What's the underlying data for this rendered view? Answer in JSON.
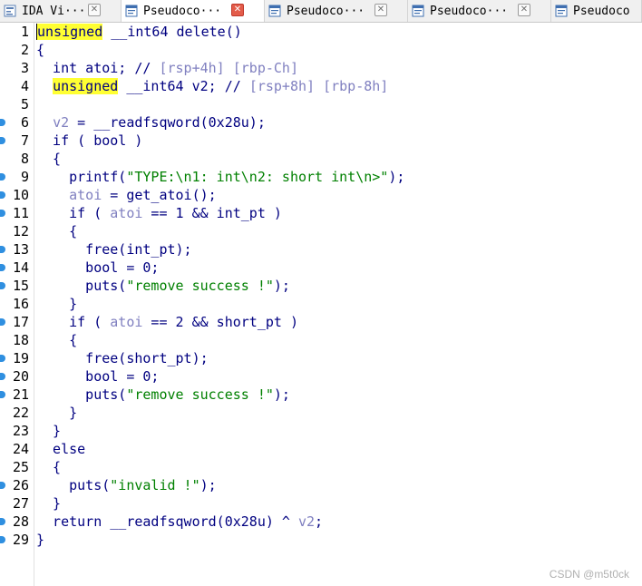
{
  "tabs": [
    {
      "label": "IDA Vi···",
      "icon": "ida-view-icon",
      "active": false
    },
    {
      "label": "Pseudoco···",
      "icon": "pseudocode-icon",
      "active": true
    },
    {
      "label": "Pseudoco···",
      "icon": "pseudocode-icon",
      "active": false
    },
    {
      "label": "Pseudoco···",
      "icon": "pseudocode-icon",
      "active": false
    },
    {
      "label": "Pseudoco",
      "icon": "pseudocode-icon",
      "active": false
    }
  ],
  "colors": {
    "keyword": "#000080",
    "highlight": "#ffff33",
    "comment": "#8080c0",
    "string": "#008000",
    "breakpoint_dot": "#2f8fe0",
    "active_close": "#e35c4a"
  },
  "code_lines": [
    {
      "n": "1",
      "dot": false,
      "cursor": true,
      "tokens": [
        {
          "t": "unsigned",
          "c": "hl"
        },
        {
          "t": " __int64 delete()",
          "c": "kw"
        }
      ]
    },
    {
      "n": "2",
      "dot": false,
      "tokens": [
        {
          "t": "{",
          "c": "kw"
        }
      ]
    },
    {
      "n": "3",
      "dot": false,
      "tokens": [
        {
          "t": "  int atoi; // ",
          "c": "kw"
        },
        {
          "t": "[rsp+4h] [rbp-Ch]",
          "c": "cm"
        }
      ]
    },
    {
      "n": "4",
      "dot": false,
      "tokens": [
        {
          "t": "  ",
          "c": "kw"
        },
        {
          "t": "unsigned",
          "c": "hl"
        },
        {
          "t": " __int64 v2; // ",
          "c": "kw"
        },
        {
          "t": "[rsp+8h] [rbp-8h]",
          "c": "cm"
        }
      ]
    },
    {
      "n": "5",
      "dot": false,
      "tokens": []
    },
    {
      "n": "6",
      "dot": true,
      "tokens": [
        {
          "t": "  ",
          "c": "kw"
        },
        {
          "t": "v2",
          "c": "var"
        },
        {
          "t": " = __readfsqword(0x28u);",
          "c": "kw"
        }
      ]
    },
    {
      "n": "7",
      "dot": true,
      "tokens": [
        {
          "t": "  if ( bool )",
          "c": "kw"
        }
      ]
    },
    {
      "n": "8",
      "dot": false,
      "tokens": [
        {
          "t": "  {",
          "c": "kw"
        }
      ]
    },
    {
      "n": "9",
      "dot": true,
      "tokens": [
        {
          "t": "    printf(",
          "c": "kw"
        },
        {
          "t": "\"TYPE:\\n1: int\\n2: short int\\n>\"",
          "c": "str"
        },
        {
          "t": ");",
          "c": "kw"
        }
      ]
    },
    {
      "n": "10",
      "dot": true,
      "tokens": [
        {
          "t": "    ",
          "c": "kw"
        },
        {
          "t": "atoi",
          "c": "var"
        },
        {
          "t": " = get_atoi();",
          "c": "kw"
        }
      ]
    },
    {
      "n": "11",
      "dot": true,
      "tokens": [
        {
          "t": "    if ( ",
          "c": "kw"
        },
        {
          "t": "atoi",
          "c": "var"
        },
        {
          "t": " == 1 && int_pt )",
          "c": "kw"
        }
      ]
    },
    {
      "n": "12",
      "dot": false,
      "tokens": [
        {
          "t": "    {",
          "c": "kw"
        }
      ]
    },
    {
      "n": "13",
      "dot": true,
      "tokens": [
        {
          "t": "      free(int_pt);",
          "c": "kw"
        }
      ]
    },
    {
      "n": "14",
      "dot": true,
      "tokens": [
        {
          "t": "      bool = 0;",
          "c": "kw"
        }
      ]
    },
    {
      "n": "15",
      "dot": true,
      "tokens": [
        {
          "t": "      puts(",
          "c": "kw"
        },
        {
          "t": "\"remove success !\"",
          "c": "str"
        },
        {
          "t": ");",
          "c": "kw"
        }
      ]
    },
    {
      "n": "16",
      "dot": false,
      "tokens": [
        {
          "t": "    }",
          "c": "kw"
        }
      ]
    },
    {
      "n": "17",
      "dot": true,
      "tokens": [
        {
          "t": "    if ( ",
          "c": "kw"
        },
        {
          "t": "atoi",
          "c": "var"
        },
        {
          "t": " == 2 && short_pt )",
          "c": "kw"
        }
      ]
    },
    {
      "n": "18",
      "dot": false,
      "tokens": [
        {
          "t": "    {",
          "c": "kw"
        }
      ]
    },
    {
      "n": "19",
      "dot": true,
      "tokens": [
        {
          "t": "      free(short_pt);",
          "c": "kw"
        }
      ]
    },
    {
      "n": "20",
      "dot": true,
      "tokens": [
        {
          "t": "      bool = 0;",
          "c": "kw"
        }
      ]
    },
    {
      "n": "21",
      "dot": true,
      "tokens": [
        {
          "t": "      puts(",
          "c": "kw"
        },
        {
          "t": "\"remove success !\"",
          "c": "str"
        },
        {
          "t": ");",
          "c": "kw"
        }
      ]
    },
    {
      "n": "22",
      "dot": false,
      "tokens": [
        {
          "t": "    }",
          "c": "kw"
        }
      ]
    },
    {
      "n": "23",
      "dot": false,
      "tokens": [
        {
          "t": "  }",
          "c": "kw"
        }
      ]
    },
    {
      "n": "24",
      "dot": false,
      "tokens": [
        {
          "t": "  else",
          "c": "kw"
        }
      ]
    },
    {
      "n": "25",
      "dot": false,
      "tokens": [
        {
          "t": "  {",
          "c": "kw"
        }
      ]
    },
    {
      "n": "26",
      "dot": true,
      "tokens": [
        {
          "t": "    puts(",
          "c": "kw"
        },
        {
          "t": "\"invalid !\"",
          "c": "str"
        },
        {
          "t": ");",
          "c": "kw"
        }
      ]
    },
    {
      "n": "27",
      "dot": false,
      "tokens": [
        {
          "t": "  }",
          "c": "kw"
        }
      ]
    },
    {
      "n": "28",
      "dot": true,
      "tokens": [
        {
          "t": "  return __readfsqword(0x28u) ^ ",
          "c": "kw"
        },
        {
          "t": "v2",
          "c": "var"
        },
        {
          "t": ";",
          "c": "kw"
        }
      ]
    },
    {
      "n": "29",
      "dot": true,
      "tokens": [
        {
          "t": "}",
          "c": "kw"
        }
      ]
    }
  ],
  "watermark": "CSDN @m5t0ck"
}
